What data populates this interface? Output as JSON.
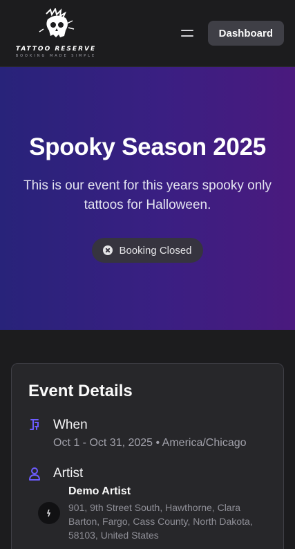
{
  "header": {
    "logo_name": "TATTOO RESERVE",
    "logo_tagline": "BOOKING MADE SIMPLE",
    "menu_icon": "hamburger-icon",
    "dashboard_label": "Dashboard"
  },
  "hero": {
    "title": "Spooky Season 2025",
    "description": "This is our event for this years spooky only tattoos for Halloween.",
    "status_icon": "x-circle-icon",
    "status_label": "Booking Closed"
  },
  "event_details": {
    "title": "Event Details",
    "when": {
      "icon": "calendar-clock-icon",
      "label": "When",
      "value": "Oct 1 - Oct 31, 2025 • America/Chicago"
    },
    "artist": {
      "icon": "user-icon",
      "label": "Artist",
      "name": "Demo Artist",
      "address": "901, 9th Street South, Hawthorne, Clara Barton, Fargo, Cass County, North Dakota, 58103, United States"
    }
  },
  "colors": {
    "accent": "#6d5cff",
    "hero_gradient_start": "#28237a",
    "hero_gradient_end": "#4a1a7e",
    "background": "#1c1c1e"
  }
}
